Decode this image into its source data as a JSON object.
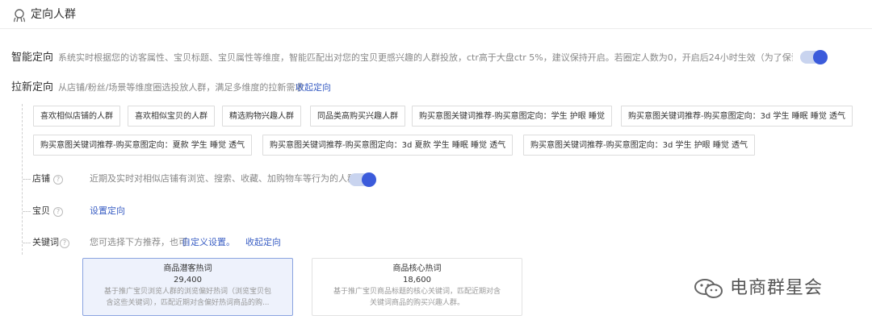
{
  "header": {
    "title": "定向人群",
    "icon": "people-icon"
  },
  "smart": {
    "label": "智能定向",
    "desc": "系统实时根据您的访客属性、宝贝标题、宝贝属性等维度，智能匹配出对您的宝贝更感兴趣的人群投放，ctr高于大盘ctr 5%，建议保持开启。若圈定人数为0，开启后24小时生效（为了保证投放效果...",
    "enabled": true
  },
  "lakexin": {
    "label": "拉新定向",
    "desc": "从店铺/粉丝/场景等维度圈选投放人群，满足多维度的拉新需求",
    "collapse_link": "收起定向"
  },
  "tags_row1": [
    "喜欢相似店铺的人群",
    "喜欢相似宝贝的人群",
    "精选购物兴趣人群",
    "同品类高购买兴趣人群",
    "购买意图关键词推荐-购买意图定向：学生 护眼 睡觉",
    "购买意图关键词推荐-购买意图定向：3d 学生 睡眠 睡觉 透气"
  ],
  "tags_row2": [
    "购买意图关键词推荐-购买意图定向：夏款 学生 睡觉 透气",
    "购买意图关键词推荐-购买意图定向：3d 夏款 学生 睡眠 睡觉 透气",
    "购买意图关键词推荐-购买意图定向：3d 学生 护眼 睡觉 透气"
  ],
  "shop": {
    "label": "店铺",
    "desc": "近期及实时对相似店铺有浏览、搜索、收藏、加购物车等行为的人群",
    "enabled": true
  },
  "item": {
    "label": "宝贝",
    "link": "设置定向"
  },
  "keyword": {
    "label": "关键词",
    "desc": "您可选择下方推荐，也可",
    "custom_link": "自定义设置。",
    "collapse_link": "收起定向"
  },
  "help_glyph": "?",
  "cards": [
    {
      "title": "商品潜客热词",
      "count": "29,400",
      "desc1": "基于推广宝贝浏览人群的浏览偏好热词（浏览宝贝包",
      "desc2": "含这些关键词），匹配近期对含偏好热词商品的购...",
      "selected": true
    },
    {
      "title": "商品核心热词",
      "count": "18,600",
      "desc1": "基于推广宝贝商品标题的核心关键词，匹配近期对含",
      "desc2": "关键词商品的购买兴趣人群。",
      "selected": false
    }
  ],
  "watermark": {
    "text": "电商群星会",
    "icon": "wechat-icon"
  }
}
